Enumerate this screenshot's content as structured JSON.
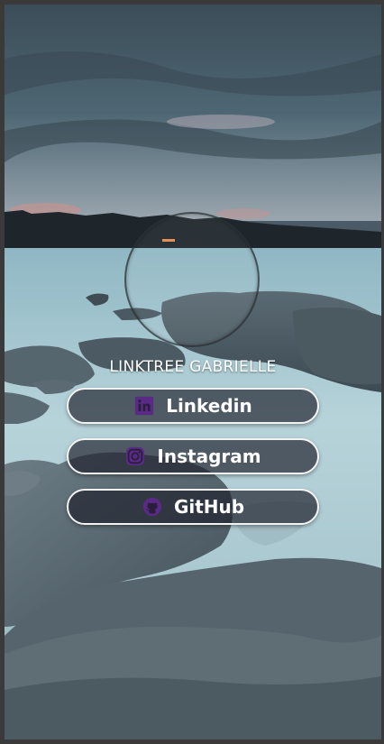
{
  "profile": {
    "title": "LINKTREE GABRIELLE"
  },
  "links": [
    {
      "label": "Linkedin",
      "icon": "linkedin-icon"
    },
    {
      "label": "Instagram",
      "icon": "instagram-icon"
    },
    {
      "label": "GitHub",
      "icon": "github-icon"
    }
  ],
  "colors": {
    "icon_accent": "#5b2a86",
    "button_border": "#f2f2f2",
    "text": "#ffffff"
  }
}
